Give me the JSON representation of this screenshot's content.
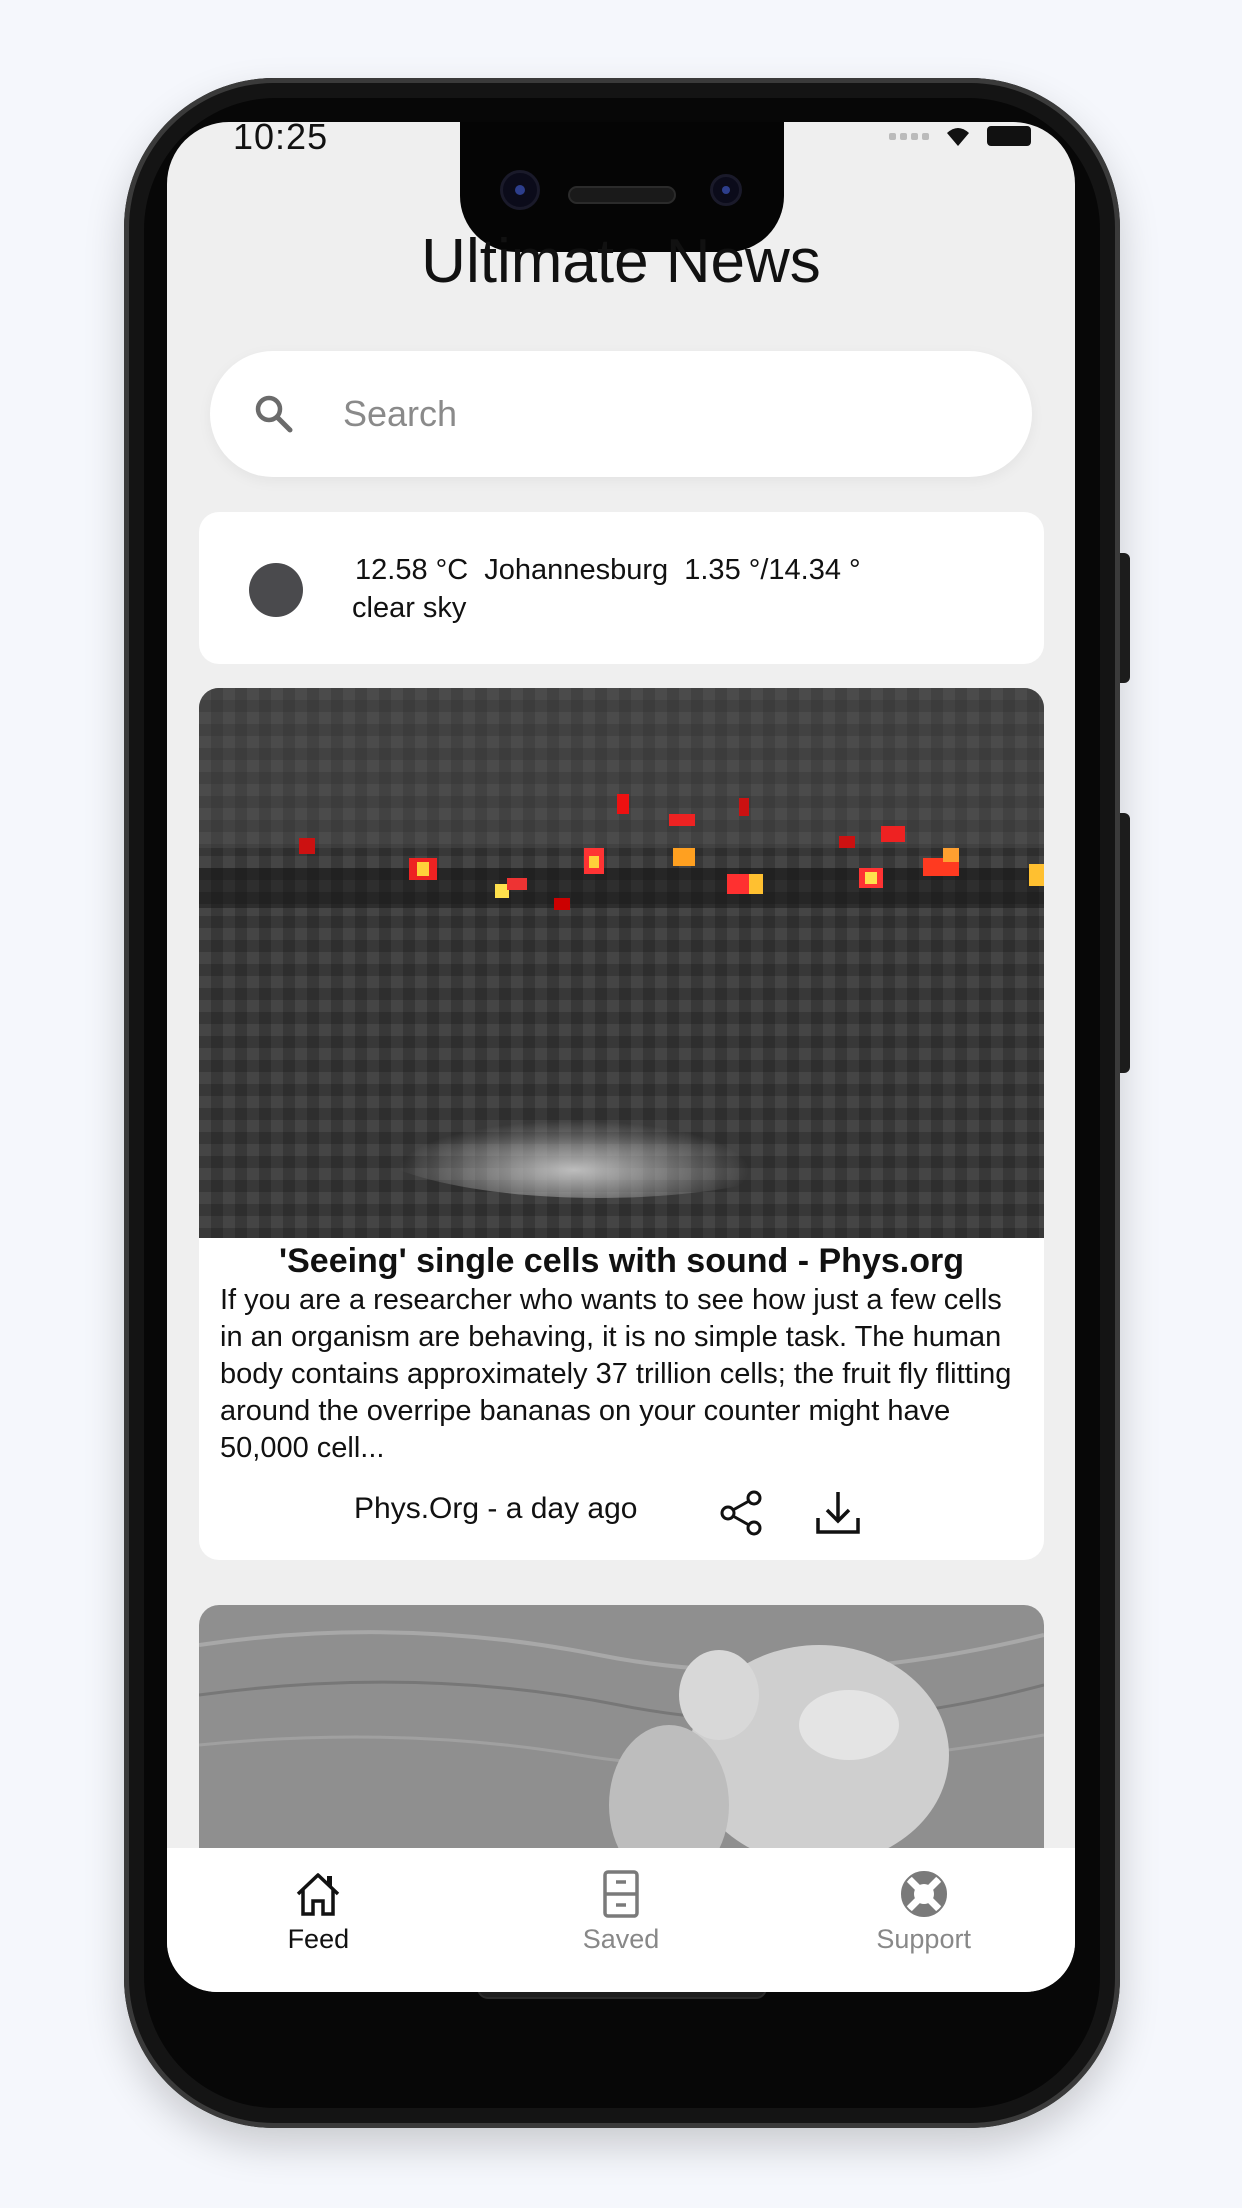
{
  "status_bar": {
    "time": "10:25"
  },
  "app": {
    "title": "Ultimate News"
  },
  "search": {
    "placeholder": "Search"
  },
  "weather": {
    "temperature": "12.58 °C",
    "city": "Johannesburg",
    "min_max": "1.35 °/14.34 °",
    "description": "clear sky"
  },
  "articles": [
    {
      "title": "'Seeing' single cells with sound - Phys.org",
      "description": "If you are a researcher who wants to see how just a few cells in an organism are behaving, it is no simple task. The human body contains approximately 37 trillion cells; the fruit fly flitting around the overripe bananas on your counter might have 50,000 cell...",
      "source_time": "Phys.Org - a day ago"
    }
  ],
  "tabbar": {
    "items": [
      {
        "label": "Feed",
        "icon": "home-icon",
        "active": true
      },
      {
        "label": "Saved",
        "icon": "archive-icon",
        "active": false
      },
      {
        "label": "Support",
        "icon": "lifebuoy-icon",
        "active": false
      }
    ]
  }
}
